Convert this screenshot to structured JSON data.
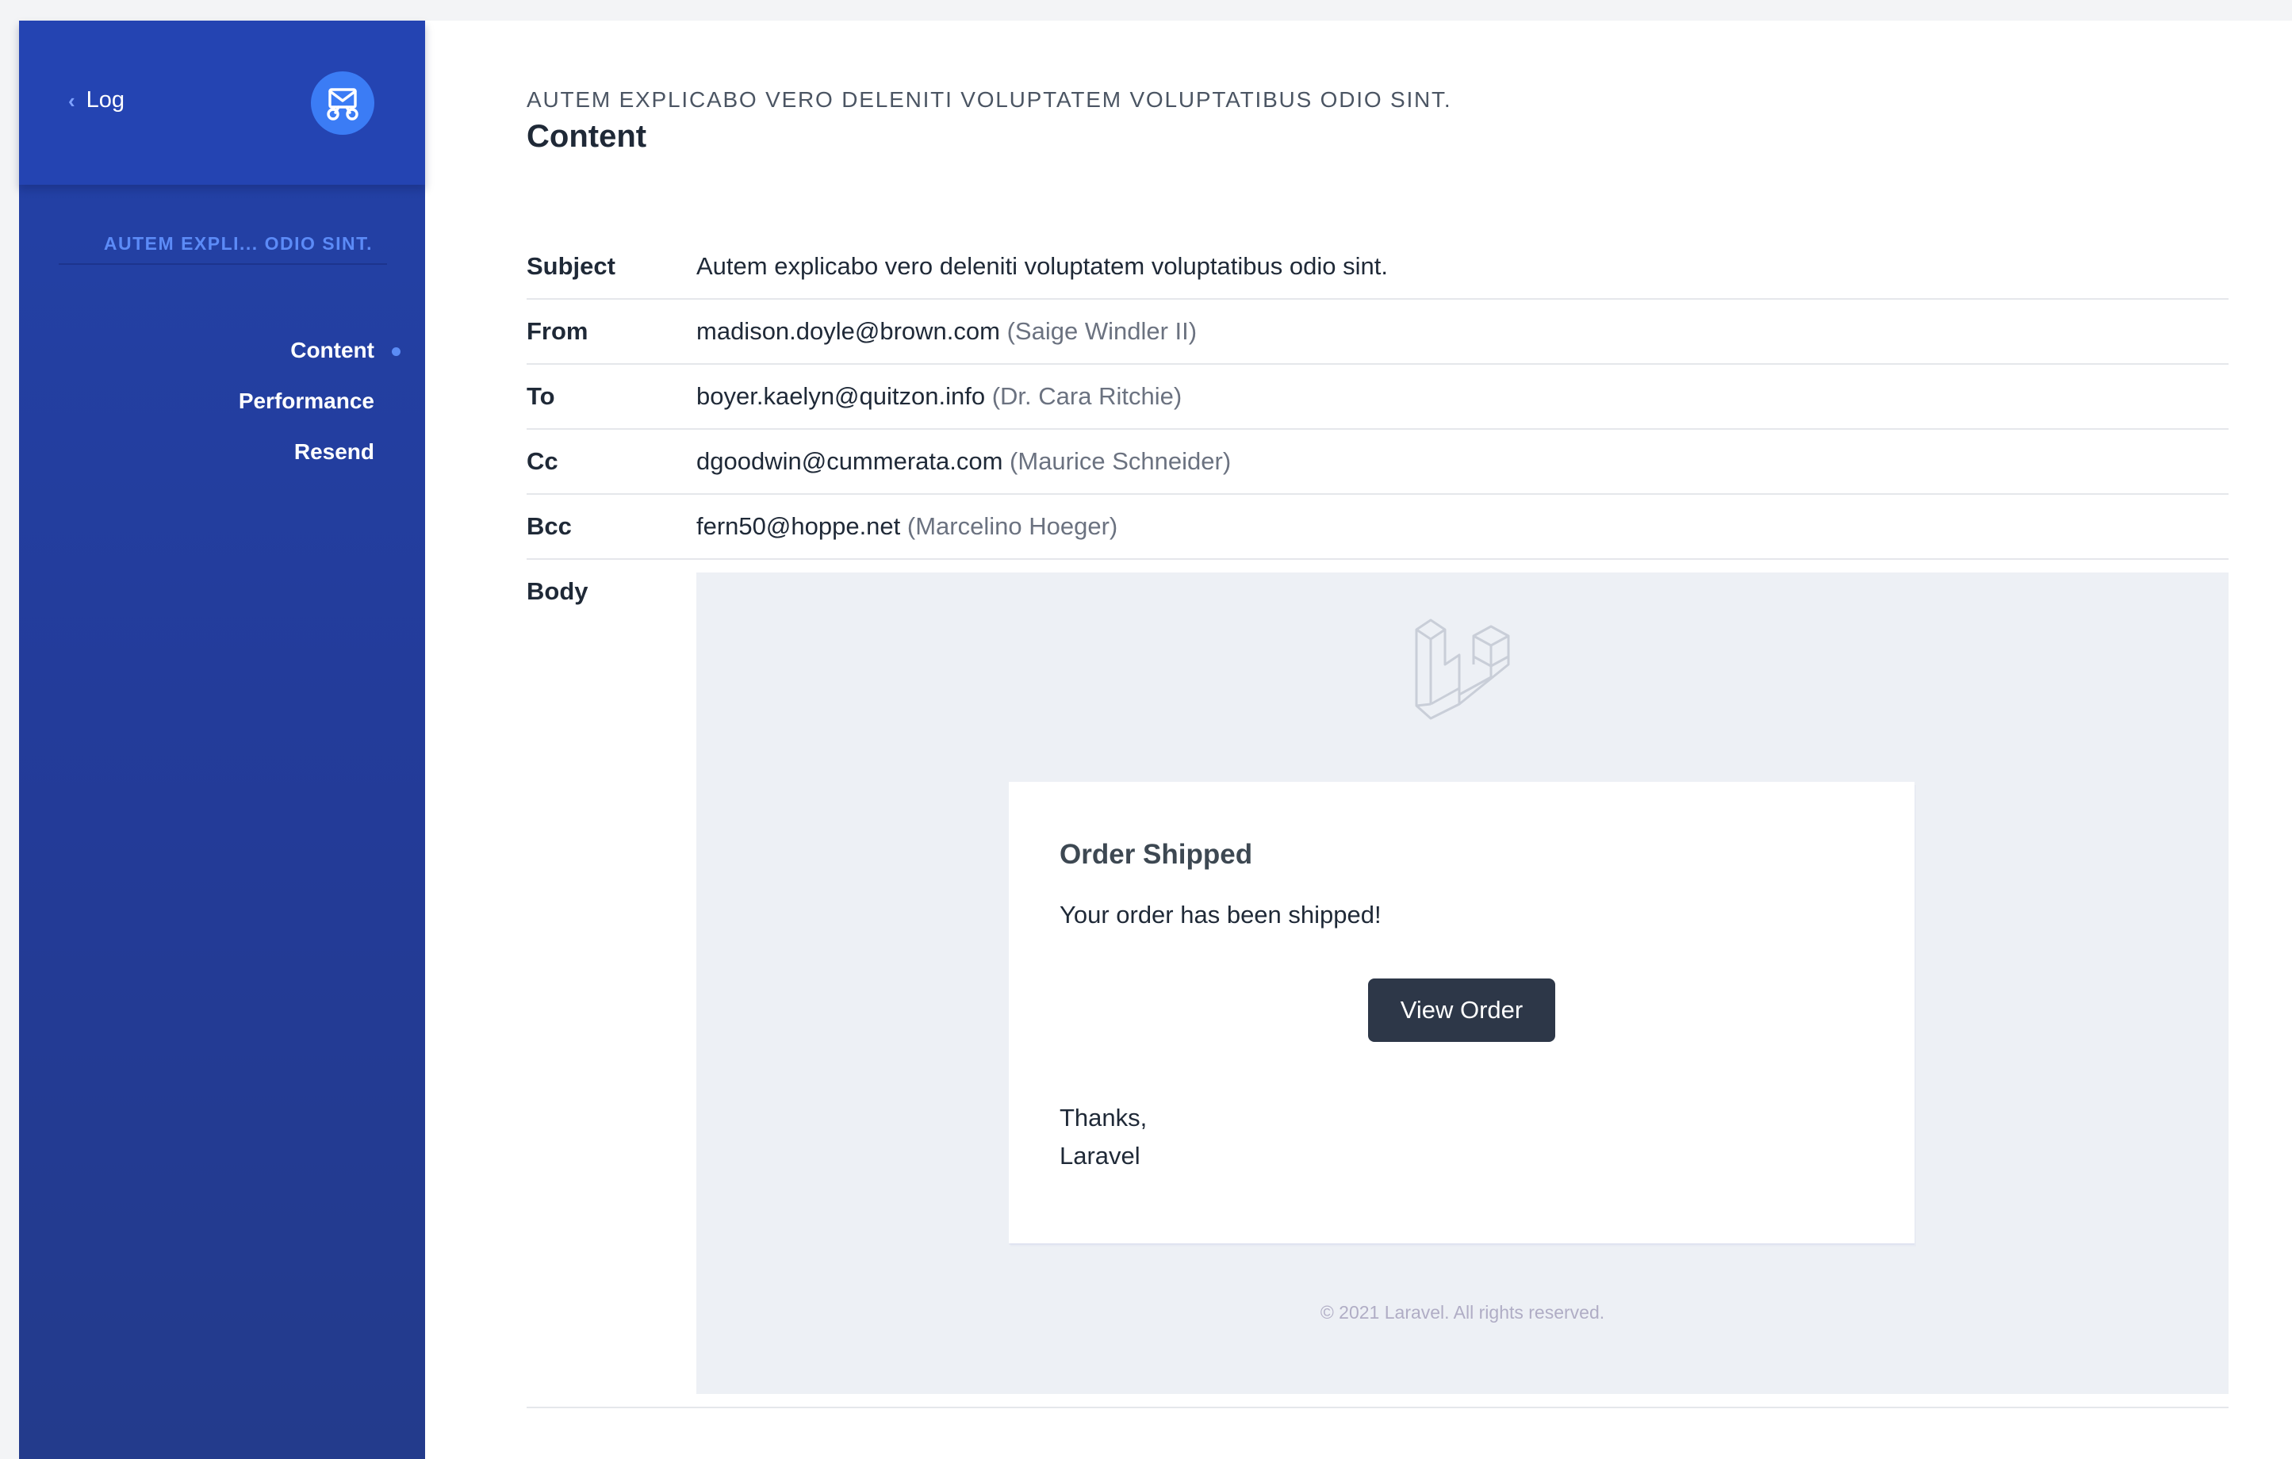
{
  "sidebar": {
    "back_label": "Log",
    "subtitle": "AUTEM EXPLI... ODIO SINT.",
    "nav": [
      {
        "label": "Content",
        "active": true
      },
      {
        "label": "Performance",
        "active": false
      },
      {
        "label": "Resend",
        "active": false
      }
    ]
  },
  "header": {
    "eyebrow": "AUTEM EXPLICABO VERO DELENITI VOLUPTATEM VOLUPTATIBUS ODIO SINT.",
    "title": "Content"
  },
  "details": {
    "subject": {
      "label": "Subject",
      "value": "Autem explicabo vero deleniti voluptatem voluptatibus odio sint."
    },
    "from": {
      "label": "From",
      "email": "madison.doyle@brown.com",
      "name": "(Saige Windler II)"
    },
    "to": {
      "label": "To",
      "email": "boyer.kaelyn@quitzon.info",
      "name": "(Dr. Cara Ritchie)"
    },
    "cc": {
      "label": "Cc",
      "email": "dgoodwin@cummerata.com",
      "name": "(Maurice Schneider)"
    },
    "bcc": {
      "label": "Bcc",
      "email": "fern50@hoppe.net",
      "name": "(Marcelino Hoeger)"
    },
    "body_label": "Body"
  },
  "email": {
    "heading": "Order Shipped",
    "text": "Your order has been shipped!",
    "button_label": "View Order",
    "sign_line1": "Thanks,",
    "sign_line2": "Laravel",
    "footer": "© 2021 Laravel. All rights reserved."
  },
  "icons": {
    "back": "chevron-left-icon",
    "app_logo": "mailbox-logo-icon",
    "email_logo": "laravel-logo-icon"
  },
  "colors": {
    "sidebar": "#2342a8",
    "accent": "#3b7cf5",
    "button": "#2d3748",
    "email_background": "#edf0f5"
  }
}
